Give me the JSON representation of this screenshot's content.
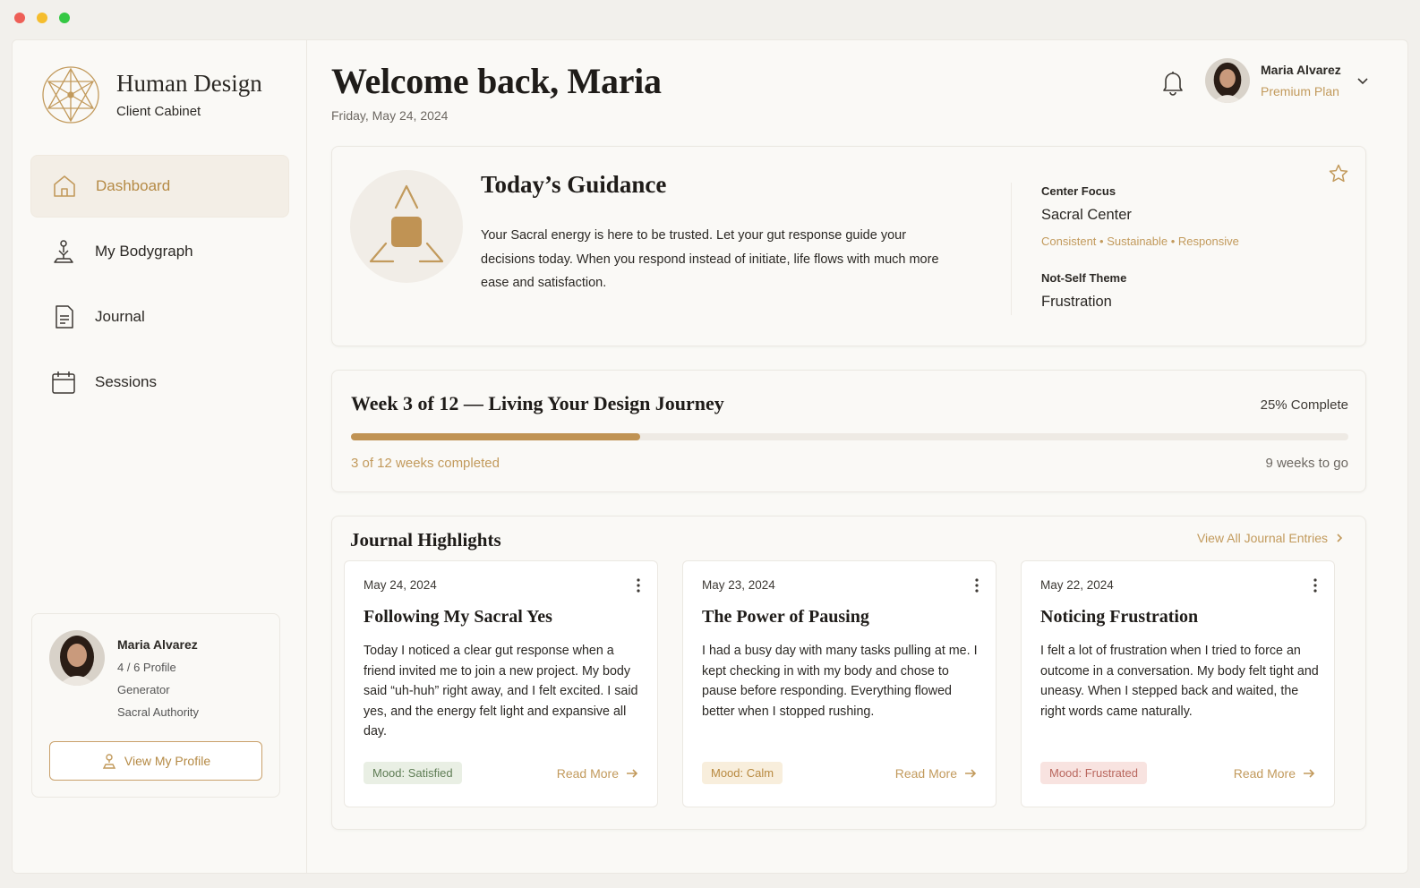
{
  "brand": {
    "title": "Human Design",
    "subtitle": "Client Cabinet",
    "icon": "geometry-logo-icon"
  },
  "nav": [
    {
      "label": "Dashboard",
      "icon": "home-icon",
      "active": true
    },
    {
      "label": "My Bodygraph",
      "icon": "bodygraph-icon",
      "active": false
    },
    {
      "label": "Journal",
      "icon": "journal-icon",
      "active": false
    },
    {
      "label": "Sessions",
      "icon": "calendar-icon",
      "active": false
    }
  ],
  "sidebar_profile": {
    "name": "Maria Alvarez",
    "profile": "4 / 6 Profile",
    "type": "Generator",
    "authority": "Sacral Authority",
    "button_label": "View My Profile"
  },
  "header": {
    "welcome": "Welcome back, Maria",
    "date": "Friday, May 24, 2024",
    "user_name": "Maria Alvarez",
    "user_plan": "Premium Plan"
  },
  "guidance": {
    "title": "Today’s Guidance",
    "text": "Your Sacral energy is here to be trusted. Let your gut response guide your decisions today. When you respond instead of initiate, life flows with much more ease and satisfaction.",
    "center_focus_label": "Center Focus",
    "center_focus_value": "Sacral Center",
    "center_focus_tags": "Consistent • Sustainable • Responsive",
    "not_self_label": "Not-Self Theme",
    "not_self_value": "Frustration"
  },
  "progress": {
    "title": "Week 3 of 12 — Living Your Design Journey",
    "complete_label": "25% Complete",
    "fraction": 0.29,
    "completed_text": "3 of 12 weeks completed",
    "remaining_text": "9 weeks to go"
  },
  "journal": {
    "title": "Journal Highlights",
    "view_all": "View All Journal Entries",
    "read_more": "Read More",
    "entries": [
      {
        "date": "May 24, 2024",
        "title": "Following My Sacral Yes",
        "body": "Today I noticed a clear gut response when a friend invited me to join a new project. My body said “uh-huh” right away, and I felt excited. I said yes, and the energy felt light and expansive all day.",
        "mood": "Mood: Satisfied"
      },
      {
        "date": "May 23, 2024",
        "title": "The Power of Pausing",
        "body": "I had a busy day with many tasks pulling at me. I kept checking in with my body and chose to pause before responding. Everything flowed better when I stopped rushing.",
        "mood": "Mood: Calm"
      },
      {
        "date": "May 22, 2024",
        "title": "Noticing Frustration",
        "body": "I felt a lot of frustration when I tried to force an outcome in a conversation. My body felt tight and uneasy. When I stepped back and waited, the right words came naturally.",
        "mood": "Mood: Frustrated"
      }
    ]
  },
  "colors": {
    "accent": "#c09354",
    "background": "#faf9f6"
  }
}
